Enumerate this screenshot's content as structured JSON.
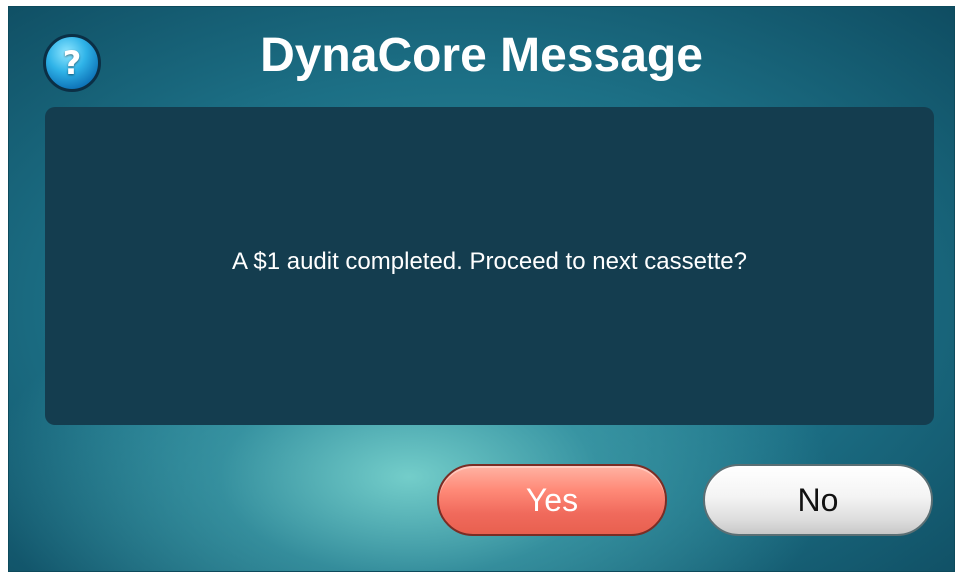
{
  "dialog": {
    "title": "DynaCore Message",
    "help_icon_glyph": "?",
    "help_icon_name": "help-question-icon",
    "message": "A $1 audit completed. Proceed to next cassette?"
  },
  "buttons": {
    "yes_label": "Yes",
    "no_label": "No"
  },
  "colors": {
    "background_accent": "#1c6f85",
    "panel": "#143d4f",
    "yes_button": "#f06a5c",
    "no_button": "#f4f4f4"
  }
}
